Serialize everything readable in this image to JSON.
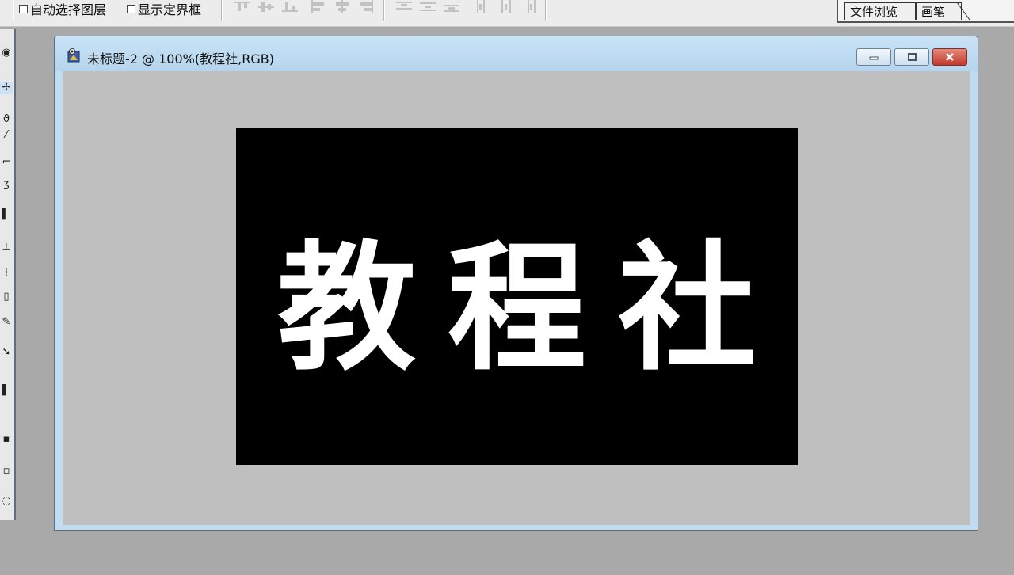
{
  "options_bar": {
    "auto_select_layer_label": "自动选择图层",
    "show_bounding_box_label": "显示定界框"
  },
  "palette_well": {
    "tabs": [
      "文件浏览",
      "画笔"
    ]
  },
  "document": {
    "title": "未标题-2 @ 100%(教程社,RGB)",
    "canvas_text": "教程社",
    "canvas_background": "#000000",
    "canvas_text_color": "#ffffff"
  },
  "icons": {
    "document": "photoshop-document-icon",
    "minimize": "minimize-icon",
    "maximize": "maximize-icon",
    "close": "close-icon"
  },
  "colors": {
    "window_frame": "#bfdcf0",
    "close_button": "#c2392a",
    "workspace": "#a9a9a9"
  }
}
